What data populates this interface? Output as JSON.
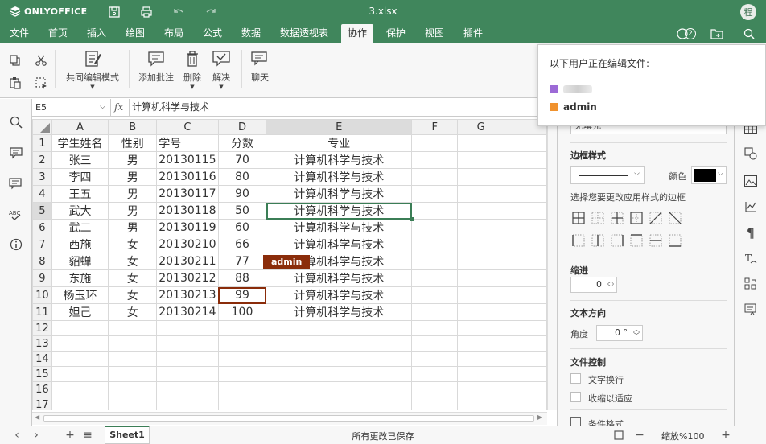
{
  "titlebar": {
    "logo_text": "ONLYOFFICE",
    "doc_title": "3.xlsx",
    "avatar_initial": "程"
  },
  "menu": {
    "tabs": [
      "文件",
      "首页",
      "插入",
      "绘图",
      "布局",
      "公式",
      "数据",
      "数据透视表",
      "协作",
      "保护",
      "视图",
      "插件"
    ],
    "active": "协作",
    "users_count": "2"
  },
  "toolbar": {
    "coedit": "共同编辑模式",
    "add_comment": "添加批注",
    "delete": "删除",
    "resolve": "解决",
    "chat": "聊天"
  },
  "formula_bar": {
    "cell_ref": "E5",
    "fx": "fx",
    "formula": "计算机科学与技术"
  },
  "grid": {
    "columns": [
      "A",
      "B",
      "C",
      "D",
      "E",
      "F",
      "G"
    ],
    "rows": [
      [
        "学生姓名",
        "性别",
        "学号",
        "分数",
        "专业"
      ],
      [
        "张三",
        "男",
        "20130115",
        "70",
        "计算机科学与技术"
      ],
      [
        "李四",
        "男",
        "20130116",
        "80",
        "计算机科学与技术"
      ],
      [
        "王五",
        "男",
        "20130117",
        "90",
        "计算机科学与技术"
      ],
      [
        "武大",
        "男",
        "20130118",
        "50",
        "计算机科学与技术"
      ],
      [
        "武二",
        "男",
        "20130119",
        "60",
        "计算机科学与技术"
      ],
      [
        "西施",
        "女",
        "20130210",
        "66",
        "计算机科学与技术"
      ],
      [
        "貂蝉",
        "女",
        "20130211",
        "77",
        "计算机科学与技术"
      ],
      [
        "东施",
        "女",
        "20130212",
        "88",
        "计算机科学与技术"
      ],
      [
        "杨玉环",
        "女",
        "20130213",
        "99",
        "计算机科学与技术"
      ],
      [
        "妲己",
        "女",
        "20130214",
        "100",
        "计算机科学与技术"
      ]
    ],
    "row_numbers": [
      "1",
      "2",
      "3",
      "4",
      "5",
      "6",
      "7",
      "8",
      "9",
      "10",
      "11",
      "12",
      "13",
      "14",
      "15",
      "16",
      "17",
      "18"
    ],
    "remote_user_tag": "admin"
  },
  "status": {
    "sheet_name": "Sheet1",
    "save_status": "所有更改已保存",
    "zoom": "缩放%100"
  },
  "right_panel": {
    "border_style": "边框样式",
    "color_label": "颜色",
    "border_hint": "选择您要更改应用样式的边框",
    "indent": "缩进",
    "indent_value": "0",
    "text_direction": "文本方向",
    "angle_label": "角度",
    "angle_value": "0 °",
    "text_control": "文件控制",
    "wrap_text": "文字换行",
    "shrink_fit": "收缩以适应",
    "partial_top": "无填充",
    "partial_bottom": "条件格式"
  },
  "popover": {
    "title": "以下用户正在编辑文件:",
    "users": [
      {
        "name": "",
        "color": "#9c6ad6"
      },
      {
        "name": "admin",
        "color": "#f0922e"
      }
    ]
  },
  "colors": {
    "brand": "#40865c",
    "remote": "#8a2c0a",
    "selection": "#3b7e56"
  }
}
